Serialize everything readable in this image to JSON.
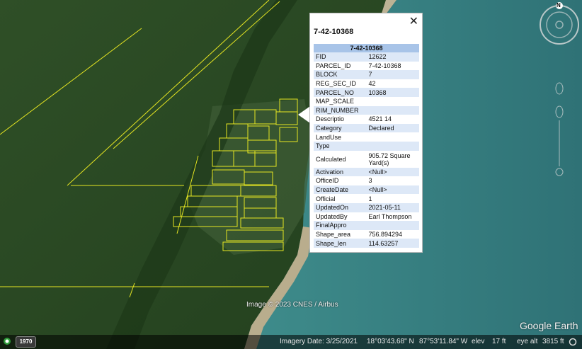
{
  "popup": {
    "title": "7-42-10368",
    "table_header": "7-42-10368",
    "close_label": "✕",
    "rows": [
      {
        "key": "FID",
        "value": "12622"
      },
      {
        "key": "PARCEL_ID",
        "value": "7-42-10368"
      },
      {
        "key": "BLOCK",
        "value": "7"
      },
      {
        "key": "REG_SEC_ID",
        "value": "42"
      },
      {
        "key": "PARCEL_NO",
        "value": "10368"
      },
      {
        "key": "MAP_SCALE",
        "value": ""
      },
      {
        "key": "RIM_NUMBER",
        "value": ""
      },
      {
        "key": "Descriptio",
        "value": "4521 14"
      },
      {
        "key": "Category",
        "value": "Declared"
      },
      {
        "key": "LandUse",
        "value": ""
      },
      {
        "key": "Type",
        "value": ""
      },
      {
        "key": "Calculated",
        "value": "905.72 Square Yard(s)"
      },
      {
        "key": "Activation",
        "value": "<Null>"
      },
      {
        "key": "OfficeID",
        "value": "3"
      },
      {
        "key": "CreateDate",
        "value": "<Null>"
      },
      {
        "key": "Official",
        "value": "1"
      },
      {
        "key": "UpdatedOn",
        "value": "2021-05-11"
      },
      {
        "key": "UpdatedBy",
        "value": "Earl Thompson"
      },
      {
        "key": "FinalAppro",
        "value": ""
      },
      {
        "key": "Shape_area",
        "value": "756.894294"
      },
      {
        "key": "Shape_len",
        "value": "114.63257"
      }
    ]
  },
  "map": {
    "copyright": "Image © 2023 CNES / Airbus",
    "watermark": "Google Earth",
    "compass_label": "N"
  },
  "status_bar": {
    "year": "1970",
    "imagery_date": "Imagery Date: 3/25/2021",
    "lat": "18°03'43.68\" N",
    "lon": "87°53'11.84\" W",
    "elev_label": "elev",
    "elev_value": "17 ft",
    "eye_alt_label": "eye alt",
    "eye_alt_value": "3815 ft"
  },
  "colors": {
    "forest": "#2b4a24",
    "sea": "#3f8d8c",
    "parcel_line": "#e6e622",
    "header_blue": "#a8c4e8"
  }
}
